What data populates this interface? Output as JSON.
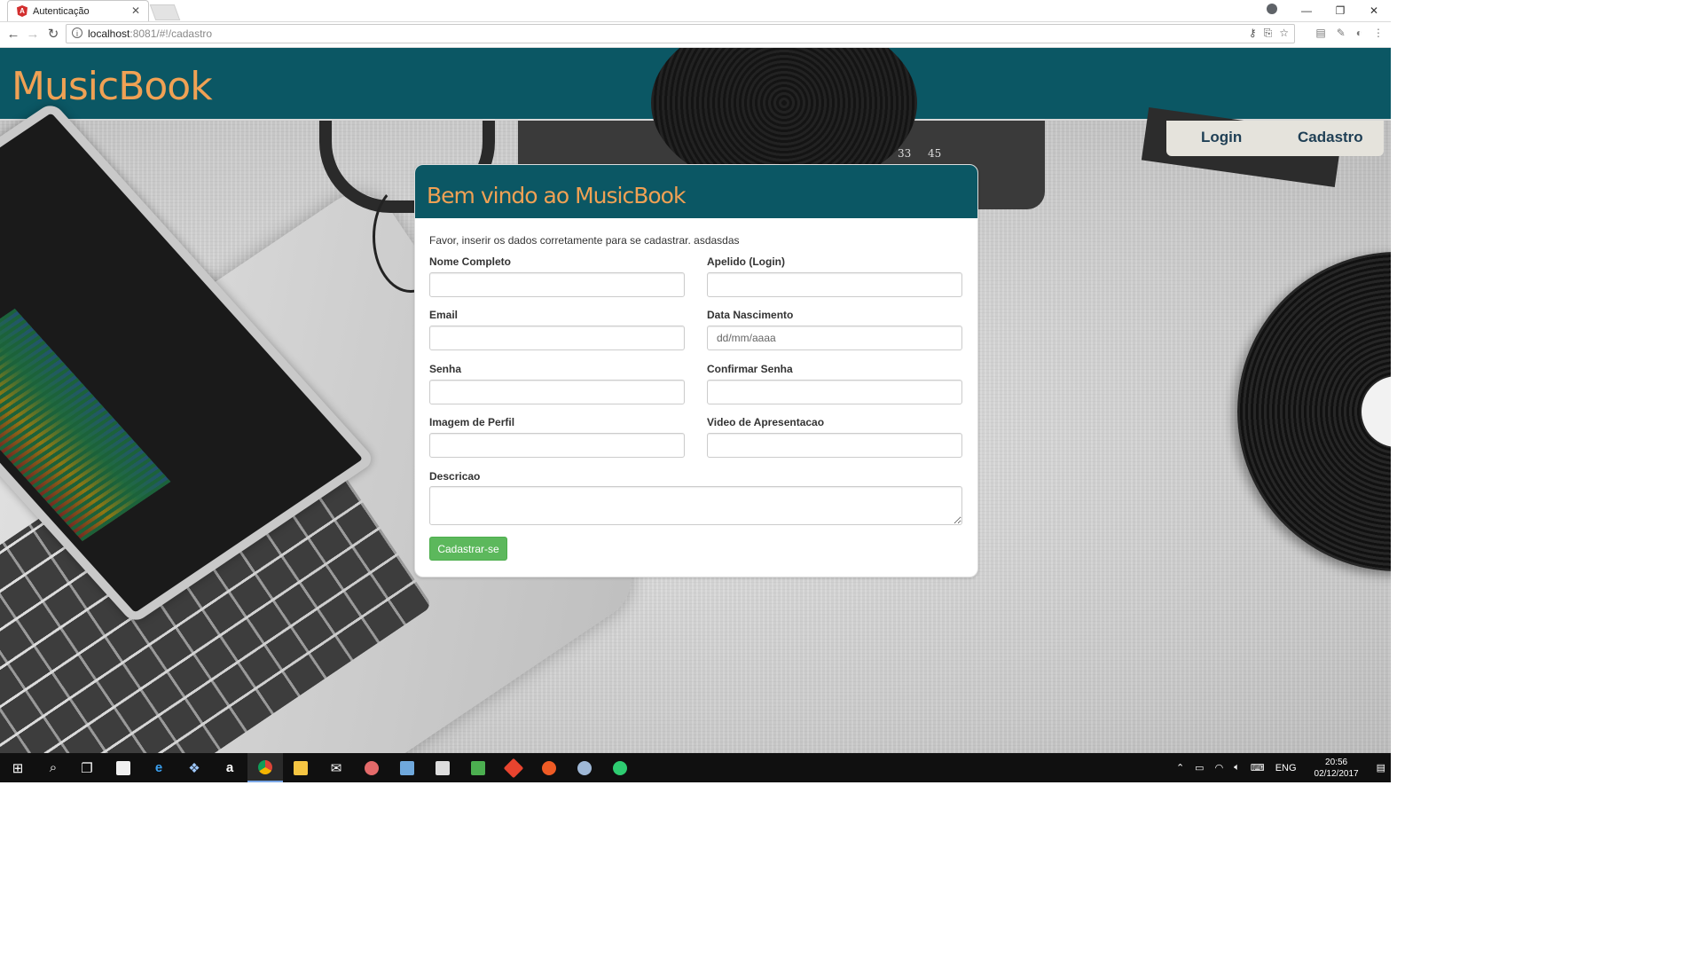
{
  "browser": {
    "tab_title": "Autenticação",
    "tab_close": "✕",
    "url_host": "localhost",
    "url_rest": ":8081/#!/cadastro",
    "win_min": "—",
    "win_restore": "❐",
    "win_close": "✕"
  },
  "header": {
    "brand": "MusicBook"
  },
  "nav": {
    "login": "Login",
    "cadastro": "Cadastro"
  },
  "decor": {
    "dial_33": "33",
    "dial_45": "45"
  },
  "card": {
    "title": "Bem vindo ao MusicBook",
    "intro": "Favor, inserir os dados corretamente para se cadastrar. asdasdas",
    "fields": {
      "nome_label": "Nome Completo",
      "apelido_label": "Apelido (Login)",
      "email_label": "Email",
      "nascimento_label": "Data Nascimento",
      "nascimento_placeholder": "dd/mm/aaaa",
      "senha_label": "Senha",
      "confirmar_label": "Confirmar Senha",
      "imagem_label": "Imagem de Perfil",
      "video_label": "Video de Apresentacao",
      "descricao_label": "Descricao"
    },
    "submit": "Cadastrar-se"
  },
  "taskbar": {
    "language": "ENG",
    "time": "20:56",
    "date": "02/12/2017"
  },
  "colors": {
    "header_bg": "#0b5764",
    "brand_orange": "#f0a154",
    "button_green": "#5cb85c",
    "nav_text": "#1f3f55"
  }
}
